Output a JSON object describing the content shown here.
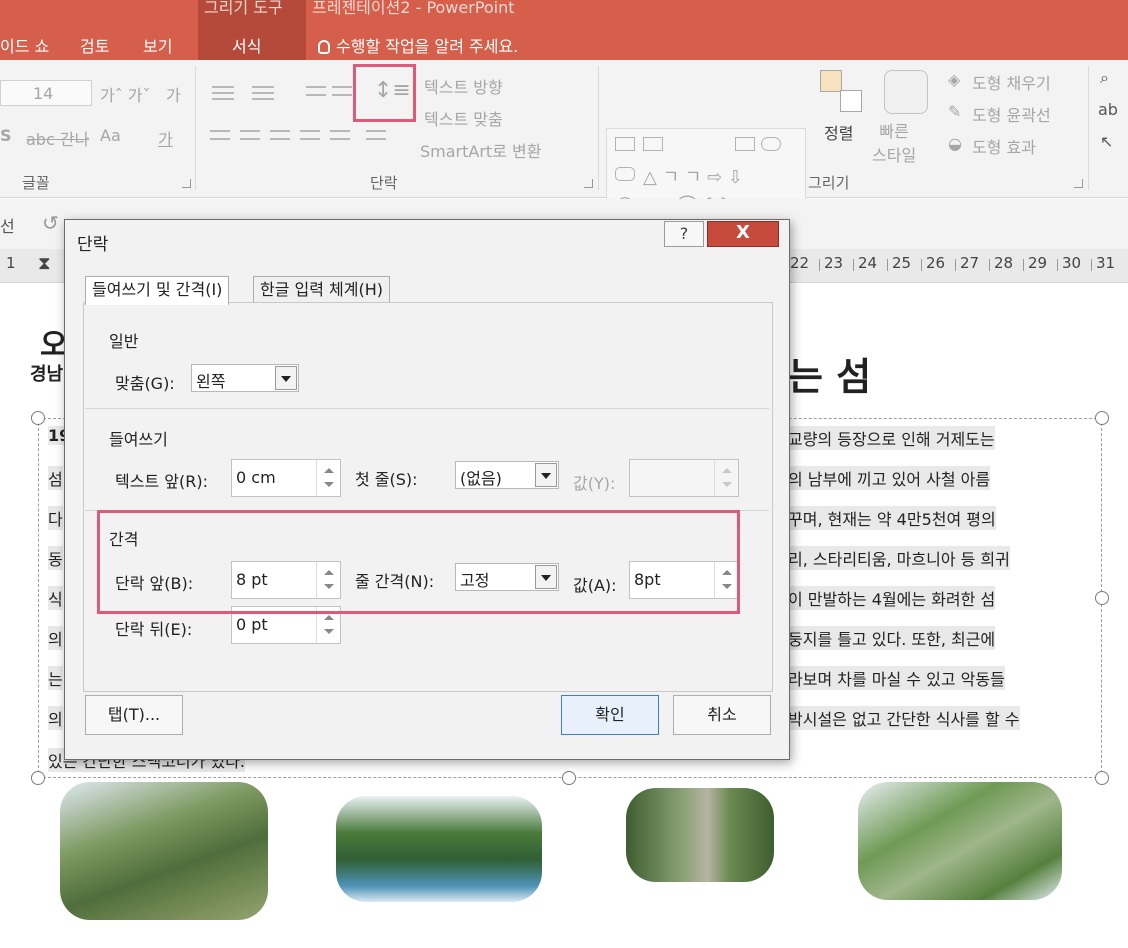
{
  "window": {
    "title_left": "그리기 도구",
    "title_right": "프레젠테이션2 - PowerPoint"
  },
  "tabs": [
    {
      "label": "이드 쇼"
    },
    {
      "label": "검토"
    },
    {
      "label": "보기"
    },
    {
      "label": "서식"
    }
  ],
  "tell_me": "수행할 작업을 알려 주세요.",
  "ribbon": {
    "font_group": {
      "label": "글꼴",
      "font_size": "14"
    },
    "paragraph_group": {
      "label": "단락",
      "text_direction": "텍스트 방향",
      "text_align": "텍스트 맞춤",
      "smartart": "SmartArt로 변환"
    },
    "drawing_group": {
      "label": "그리기",
      "arrange": "정렬",
      "quick_styles": "빠른\n스타일",
      "shape_fill": "도형 채우기",
      "shape_outline": "도형 윤곽선",
      "shape_effects": "도형 효과"
    }
  },
  "qat": {
    "left_text": "선"
  },
  "ruler": {
    "numbers": [
      "1",
      "22",
      "23",
      "24",
      "25",
      "26",
      "27",
      "28",
      "29",
      "30",
      "31"
    ]
  },
  "slide": {
    "title_fragment": "오",
    "subtitle_fragment": "경남",
    "title_right_fragment": "는 섬",
    "left_fragments": [
      "19",
      "섬",
      "다",
      "동",
      "식",
      "의",
      "는",
      "의"
    ],
    "right_lines": [
      "교량의 등장으로 인해 거제도는",
      "의 남부에 끼고 있어 사철 아름",
      "꾸며, 현재는 약 4만5천여 평의",
      "리, 스타리티움, 마흐니아 등 희귀",
      "이 만발하는 4월에는 화려한 섬",
      "둥지를 틀고 있다. 또한, 최근에",
      "라보며 차를 마실 수 있고 악동들",
      "박시설은 없고 간단한 식사를 할 수"
    ],
    "last_line": "있는 간단한 스낵코너가 있다."
  },
  "dialog": {
    "title": "단락",
    "help": "?",
    "close": "X",
    "tabs": [
      {
        "label": "들여쓰기 및 간격(I)"
      },
      {
        "label": "한글 입력 체계(H)"
      }
    ],
    "general": {
      "heading": "일반",
      "alignment_label": "맞춤(G):",
      "alignment_value": "왼쪽"
    },
    "indentation": {
      "heading": "들여쓰기",
      "before_text_label": "텍스트 앞(R):",
      "before_text_value": "0 cm",
      "first_line_label": "첫 줄(S):",
      "first_line_value": "(없음)",
      "by_label": "값(Y):",
      "by_value": ""
    },
    "spacing": {
      "heading": "간격",
      "before_label": "단락 앞(B):",
      "before_value": "8 pt",
      "line_spacing_label": "줄 간격(N):",
      "line_spacing_value": "고정",
      "at_label": "값(A):",
      "at_value": "8pt",
      "after_label": "단락 뒤(E):",
      "after_value": "0 pt"
    },
    "buttons": {
      "tabs": "탭(T)...",
      "ok": "확인",
      "cancel": "취소"
    }
  },
  "colors": {
    "ribbon_red": "#d55f4a",
    "highlight_pink": "#dd5a79",
    "close_red": "#c74a3c"
  }
}
